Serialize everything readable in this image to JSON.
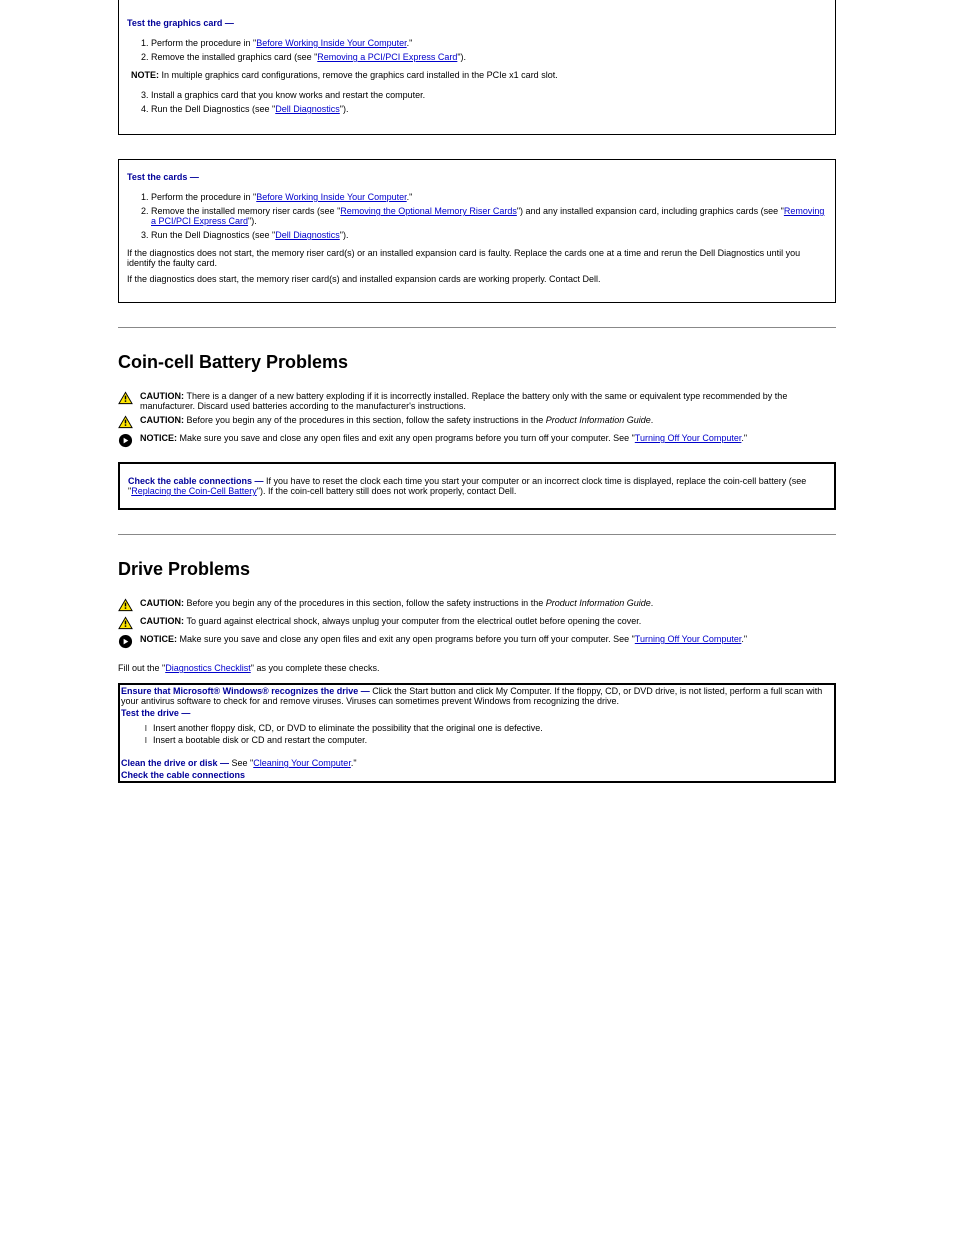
{
  "box1": {
    "lead": "Test the graphics card —",
    "steps": [
      {
        "parts": [
          {
            "t": "Perform the procedure in \"",
            "type": "txt"
          },
          {
            "t": "Before Working Inside Your Computer",
            "type": "lnk"
          },
          {
            "t": ".\"",
            "type": "txt"
          }
        ]
      },
      {
        "parts": [
          {
            "t": "Remove the installed graphics card (see \"",
            "type": "txt"
          },
          {
            "t": "Removing a PCI/PCI Express Card",
            "type": "lnk"
          },
          {
            "t": "\").",
            "type": "txt"
          }
        ]
      }
    ],
    "note_label": "NOTE:",
    "note_text": " In multiple graphics card configurations, remove the graphics card installed in the PCIe x1 card slot.",
    "steps_b": [
      {
        "parts": [
          {
            "t": "Install a graphics card that you know works and restart the computer.",
            "type": "txt"
          }
        ]
      },
      {
        "parts": [
          {
            "t": "Run the Dell Diagnostics (see \"",
            "type": "txt"
          },
          {
            "t": "Dell Diagnostics",
            "type": "lnk"
          },
          {
            "t": "\").",
            "type": "txt"
          }
        ]
      }
    ]
  },
  "box2": {
    "lead": "Test the cards —",
    "steps": [
      {
        "parts": [
          {
            "t": "Perform the procedure in \"",
            "type": "txt"
          },
          {
            "t": "Before Working Inside Your Computer",
            "type": "lnk"
          },
          {
            "t": ".\"",
            "type": "txt"
          }
        ]
      },
      {
        "parts": [
          {
            "t": "Remove the installed memory riser cards (see \"",
            "type": "txt"
          },
          {
            "t": "Removing the Optional Memory Riser Cards",
            "type": "lnk"
          },
          {
            "t": "\") and any installed expansion card, including graphics cards (see \"",
            "type": "txt"
          },
          {
            "t": "Removing a PCI/PCI Express Card",
            "type": "lnk"
          },
          {
            "t": "\").",
            "type": "txt"
          }
        ]
      },
      {
        "parts": [
          {
            "t": "Run the Dell Diagnostics (see \"",
            "type": "txt"
          },
          {
            "t": "Dell Diagnostics",
            "type": "lnk"
          },
          {
            "t": "\").",
            "type": "txt"
          }
        ]
      }
    ],
    "tail": "If the diagnostics does not start, the memory riser card(s) or an installed expansion card is faulty. Replace the cards one at a time and rerun the Dell Diagnostics until you identify the faulty card.",
    "tail2": "If the diagnostics does start, the memory riser card(s) and installed expansion cards are working properly. Contact Dell."
  },
  "coin": {
    "title": "Coin-cell Battery Problems",
    "caution1_b": "CAUTION: ",
    "caution1": "There is a danger of a new battery exploding if it is incorrectly installed. Replace the battery only with the same or equivalent type recommended by the manufacturer. Discard used batteries according to the manufacturer's instructions.",
    "caution2_b": "CAUTION: ",
    "caution2_pre": "Before you begin any of the procedures in this section, follow the safety instructions in the ",
    "caution2_i": "Product Information Guide",
    "caution2_post": ".",
    "notice_b": "NOTICE: ",
    "notice_pre": "Make sure you save and close any open files and exit any open programs before you turn off your computer. See \"",
    "notice_lnk": "Turning Off Your Computer",
    "notice_post": ".\"",
    "box_lead": "Check the cable connections —",
    "box_txt_pre": " If you have to reset the clock each time you start your computer or an incorrect clock time is displayed, replace the coin-cell battery (see \"",
    "box_lnk": "Replacing the Coin-Cell Battery",
    "box_txt_post": "\"). If the coin-cell battery still does not work properly, contact Dell."
  },
  "drive": {
    "title": "Drive Problems",
    "caution_b": "CAUTION: ",
    "caution_pre": "Before you begin any of the procedures in this section, follow the safety instructions in the ",
    "caution_i": "Product Information Guide",
    "caution_post": ".",
    "caution2_b": "CAUTION: ",
    "caution2_txt": "To guard against electrical shock, always unplug your computer from the electrical outlet before opening the cover.",
    "notice_b": "NOTICE: ",
    "notice_pre": "Make sure you save and close any open files and exit any open programs before you turn off your computer. See \"",
    "notice_lnk": "Turning Off Your Computer",
    "notice_post": ".\"",
    "fill": "Fill out the \"",
    "fill_lnk": "Diagnostics Checklist",
    "fill_post": "\" as you complete these checks.",
    "t1_lead_pre": "Ensure that Microsoft",
    "t1_lead_mid1": " Windows",
    "t1_lead_mid2": " recognizes the drive —",
    "t1_txt": " Click the Start button and click My Computer. If the floppy, CD, or DVD drive, is not listed, perform a full scan with your antivirus software to check for and remove viruses. Viruses can sometimes prevent Windows from recognizing the drive.",
    "t2_lead": "Test the drive —",
    "t2_li1": "Insert another floppy disk, CD, or DVD to eliminate the possibility that the original one is defective.",
    "t2_li2": "Insert a bootable disk or CD and restart the computer.",
    "t3_lead": "Clean the drive or disk —",
    "t3_txt_pre": " See \"",
    "t3_lnk": "Cleaning Your Computer",
    "t3_txt_post": ".\"",
    "t4_lead": "Check the cable connections"
  }
}
